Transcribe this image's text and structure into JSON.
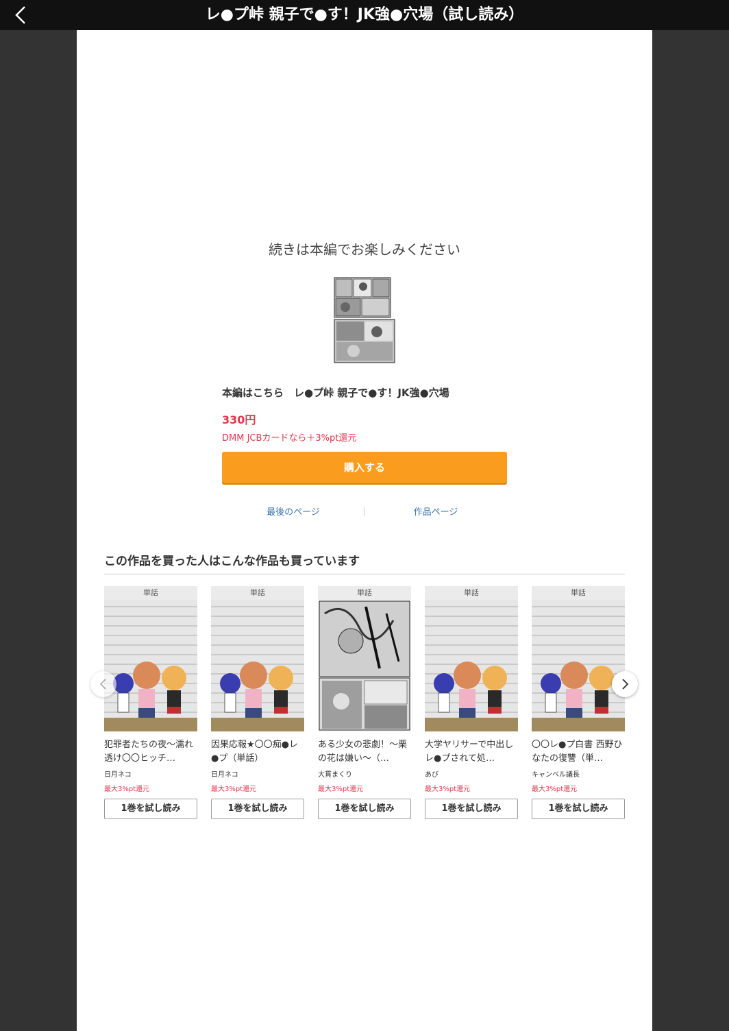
{
  "header": {
    "title": "レ●プ峠 親子で●す！JK強●穴場（試し読み）"
  },
  "end_panel": {
    "continue_text": "続きは本編でお楽しみください",
    "product_title": "本編はこちら　レ●プ峠 親子で●す！JK強●穴場",
    "price": "330円",
    "pt_note": "DMM JCBカードなら＋3%pt還元",
    "buy_label": "購入する",
    "last_page_link": "最後のページ",
    "work_page_link": "作品ページ"
  },
  "recommend": {
    "heading": "この作品を買った人はこんな作品も買っています",
    "items": [
      {
        "label": "単話",
        "title": "犯罪者たちの夜〜濡れ透け〇〇ヒッチ…",
        "author": "日月ネコ",
        "pt": "最大3%pt還元",
        "button": "1巻を試し読み"
      },
      {
        "label": "単話",
        "title": "因果応報★〇〇痴●レ●プ（単話）",
        "author": "日月ネコ",
        "pt": "最大3%pt還元",
        "button": "1巻を試し読み"
      },
      {
        "label": "単話",
        "title": "ある少女の悲劇！〜栗の花は嫌い〜（…",
        "author": "大貫まくり",
        "pt": "最大3%pt還元",
        "button": "1巻を試し読み"
      },
      {
        "label": "単話",
        "title": "大学ヤリサーで中出しレ●プされて処…",
        "author": "あび",
        "pt": "最大3%pt還元",
        "button": "1巻を試し読み"
      },
      {
        "label": "単話",
        "title": "〇〇レ●プ白書 西野ひなたの復讐（単…",
        "author": "キャンベル議長",
        "pt": "最大3%pt還元",
        "button": "1巻を試し読み"
      }
    ]
  },
  "colors": {
    "accent_button": "#fa9c1e",
    "price_red": "#e0374d",
    "link_blue": "#3a74ad",
    "frame_gray": "#333333",
    "header_black": "#111111"
  }
}
